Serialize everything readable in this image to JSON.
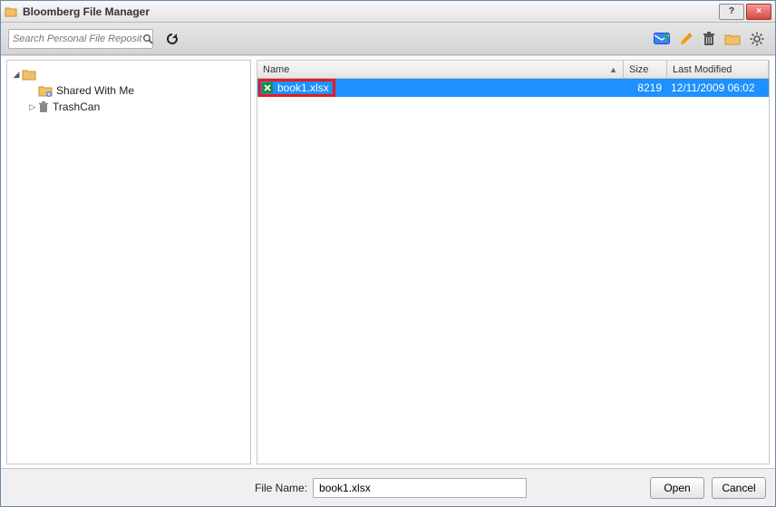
{
  "window": {
    "title": "Bloomberg File Manager",
    "help": "?",
    "close": "×"
  },
  "search": {
    "placeholder": "Search Personal File Repository"
  },
  "tree": {
    "root_label": "",
    "shared": "Shared With Me",
    "trash": "TrashCan"
  },
  "columns": {
    "name": "Name",
    "size": "Size",
    "modified": "Last Modified"
  },
  "files": [
    {
      "name": "book1.xlsx",
      "size": "8219",
      "modified": "12/11/2009 06:02"
    }
  ],
  "footer": {
    "label": "File Name:",
    "value": "book1.xlsx",
    "open": "Open",
    "cancel": "Cancel"
  }
}
